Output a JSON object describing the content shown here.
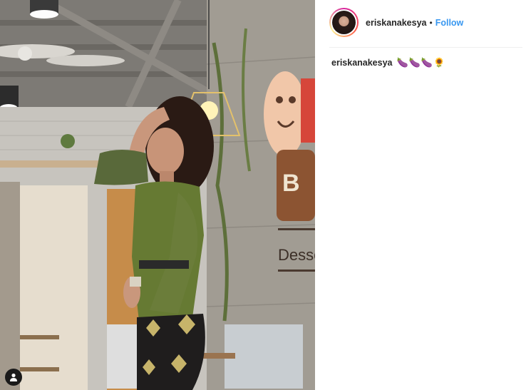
{
  "post": {
    "author": "eriskanakesya",
    "separator": "•",
    "follow_label": "Follow",
    "caption_user": "eriskanakesya",
    "caption_text": "🍆🍆🍆🌻"
  },
  "photo": {
    "tag_icon": "user-tag-icon",
    "wall_sign_fragment_1": "B",
    "wall_sign_fragment_2": "Desse"
  },
  "colors": {
    "follow": "#3897f0",
    "text": "#262626",
    "divider": "#efefef"
  }
}
